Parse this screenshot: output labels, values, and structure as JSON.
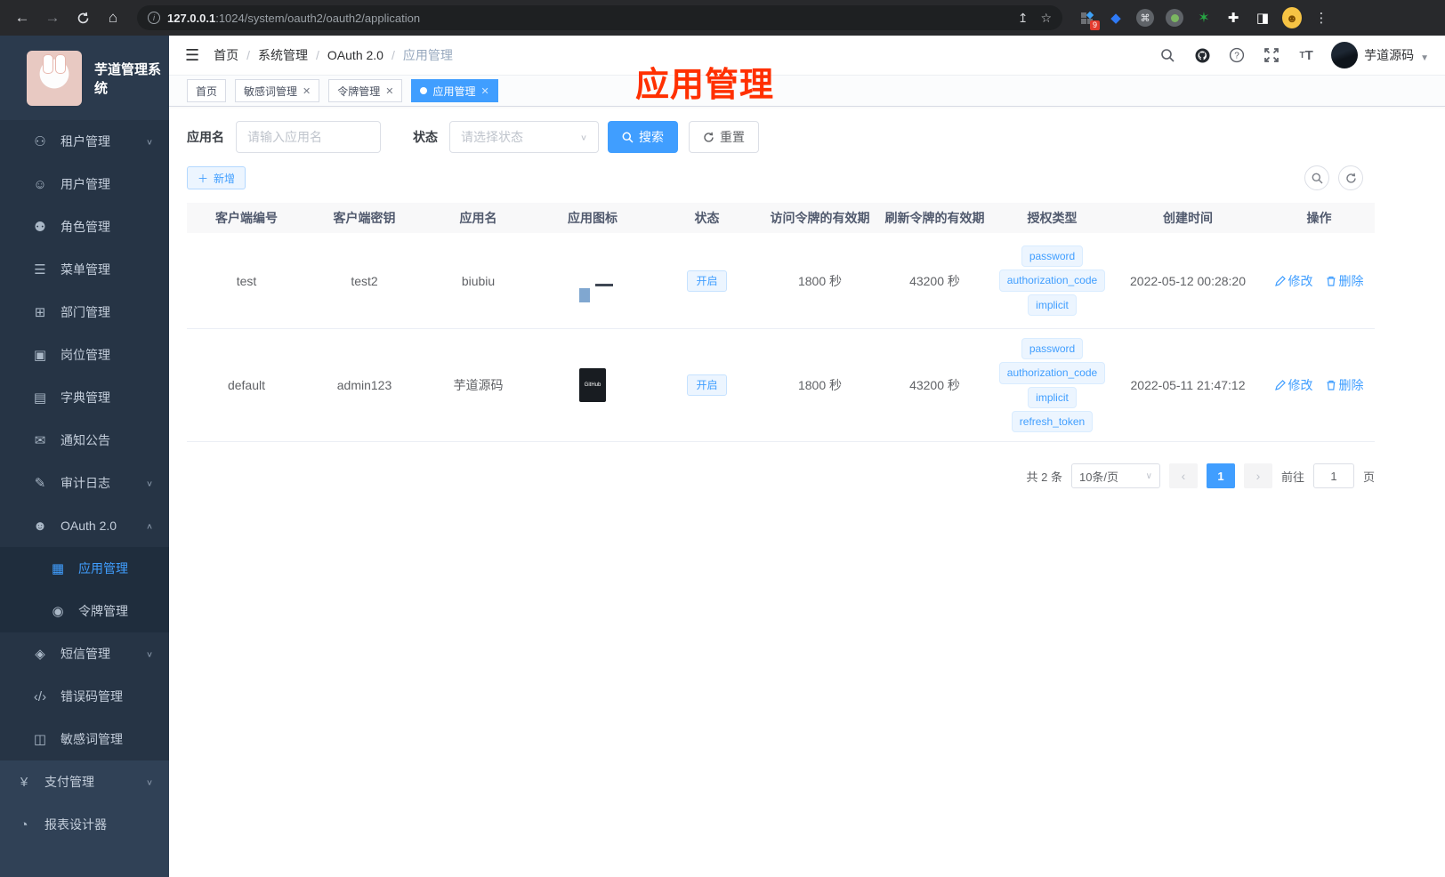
{
  "colors": {
    "accent": "#409eff",
    "annotation_red": "#ff3000",
    "sidebar_bg": "#304156"
  },
  "browser": {
    "url_host": "127.0.0.1",
    "url_rest": ":1024/system/oauth2/oauth2/application",
    "extension_badge": "9"
  },
  "sidebar": {
    "title": "芋道管理系统",
    "menu": [
      {
        "key": "tenant",
        "label": "租户管理",
        "glyph": "⚇",
        "chevron": "∨",
        "level": 1,
        "section": "sub"
      },
      {
        "key": "user",
        "label": "用户管理",
        "glyph": "☺",
        "level": 1,
        "section": "sub"
      },
      {
        "key": "role",
        "label": "角色管理",
        "glyph": "⚉",
        "level": 1,
        "section": "sub"
      },
      {
        "key": "menu",
        "label": "菜单管理",
        "glyph": "☰",
        "level": 1,
        "section": "sub"
      },
      {
        "key": "dept",
        "label": "部门管理",
        "glyph": "⊞",
        "level": 1,
        "section": "sub"
      },
      {
        "key": "post",
        "label": "岗位管理",
        "glyph": "▣",
        "level": 1,
        "section": "sub"
      },
      {
        "key": "dict",
        "label": "字典管理",
        "glyph": "▤",
        "level": 1,
        "section": "sub"
      },
      {
        "key": "notice",
        "label": "通知公告",
        "glyph": "✉",
        "level": 1,
        "section": "sub"
      },
      {
        "key": "audit",
        "label": "审计日志",
        "glyph": "✎",
        "chevron": "∨",
        "level": 1,
        "section": "sub"
      },
      {
        "key": "oauth",
        "label": "OAuth 2.0",
        "glyph": "☻",
        "chevron": "∧",
        "level": 1,
        "section": "sub"
      },
      {
        "key": "application",
        "label": "应用管理",
        "glyph": "▦",
        "level": 2,
        "section": "sub2",
        "active": true
      },
      {
        "key": "token",
        "label": "令牌管理",
        "glyph": "◉",
        "level": 2,
        "section": "sub2"
      },
      {
        "key": "sms",
        "label": "短信管理",
        "glyph": "◈",
        "chevron": "∨",
        "level": 1,
        "section": "sub"
      },
      {
        "key": "errorcode",
        "label": "错误码管理",
        "glyph": "‹/›",
        "level": 1,
        "section": "sub"
      },
      {
        "key": "sensitive",
        "label": "敏感词管理",
        "glyph": "◫",
        "level": 1,
        "section": "sub"
      },
      {
        "key": "pay",
        "label": "支付管理",
        "glyph": "¥",
        "chevron": "∨",
        "level": 0,
        "section": "top"
      },
      {
        "key": "report",
        "label": "报表设计器",
        "glyph": "◔",
        "level": 0,
        "section": "top"
      }
    ]
  },
  "header": {
    "breadcrumb": [
      "首页",
      "系统管理",
      "OAuth 2.0",
      "应用管理"
    ],
    "user_name": "芋道源码"
  },
  "tabs": [
    {
      "label": "首页"
    },
    {
      "label": "敏感词管理"
    },
    {
      "label": "令牌管理"
    },
    {
      "label": "应用管理"
    }
  ],
  "annotation": {
    "text": "应用管理"
  },
  "filters": {
    "name_label": "应用名",
    "name_placeholder": "请输入应用名",
    "status_label": "状态",
    "status_placeholder": "请选择状态",
    "search_label": "搜索",
    "reset_label": "重置"
  },
  "toolbar": {
    "add_label": "新增"
  },
  "table": {
    "columns": [
      "客户端编号",
      "客户端密钥",
      "应用名",
      "应用图标",
      "状态",
      "访问令牌的有效期",
      "刷新令牌的有效期",
      "授权类型",
      "创建时间",
      "操作"
    ],
    "rows": [
      {
        "client_id": "test",
        "secret": "test2",
        "name": "biubiu",
        "status": "开启",
        "access_validity": "1800 秒",
        "refresh_validity": "43200 秒",
        "grants": [
          "password",
          "authorization_code",
          "implicit"
        ],
        "created": "2022-05-12 00:28:20",
        "edit": "修改",
        "delete": "删除"
      },
      {
        "client_id": "default",
        "secret": "admin123",
        "name": "芋道源码",
        "status": "开启",
        "access_validity": "1800 秒",
        "refresh_validity": "43200 秒",
        "grants": [
          "password",
          "authorization_code",
          "implicit",
          "refresh_token"
        ],
        "created": "2022-05-11 21:47:12",
        "edit": "修改",
        "delete": "删除",
        "icon_label": "GitHub"
      }
    ]
  },
  "pagination": {
    "total": "共 2 条",
    "page_size": "10条/页",
    "current_page": "1",
    "goto_label": "前往",
    "goto_value": "1",
    "page_suffix": "页"
  }
}
